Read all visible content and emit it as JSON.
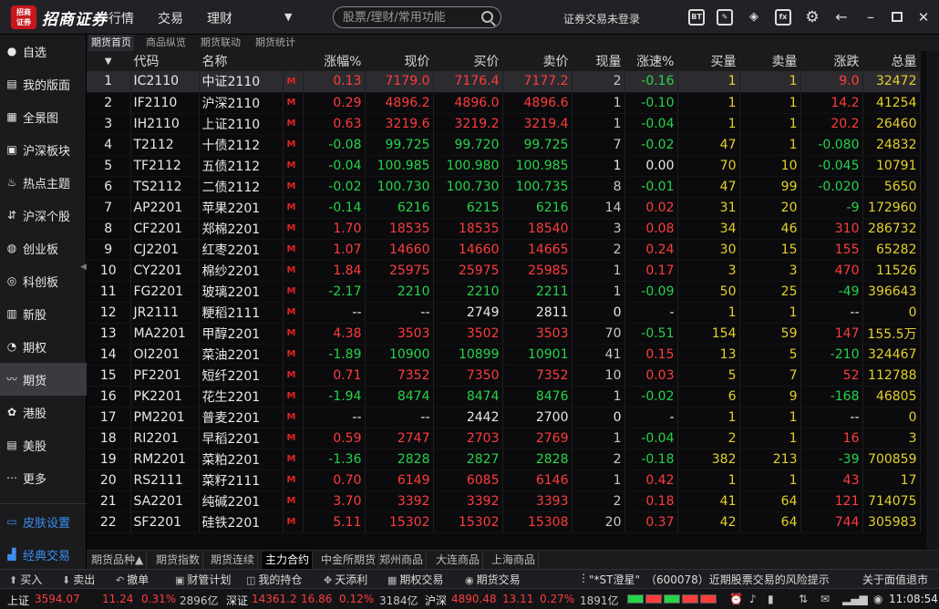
{
  "app": {
    "logo_mark": "招商证券",
    "brand": "招商证券",
    "menus": [
      "行情",
      "交易",
      "理财"
    ],
    "search_placeholder": "股票/理财/常用功能",
    "login_status": "证券交易未登录",
    "title_icons": [
      "bt-icon",
      "edit-icon",
      "cube-icon",
      "fx-icon",
      "gear-icon",
      "back-arrow-icon",
      "minimize-icon",
      "maximize-icon",
      "close-icon"
    ]
  },
  "sidebar": {
    "items": [
      {
        "label": "自选",
        "icon": "favorite-icon"
      },
      {
        "label": "我的版面",
        "icon": "layout-icon"
      },
      {
        "label": "全景图",
        "icon": "panorama-icon"
      },
      {
        "label": "沪深板块",
        "icon": "sh-sector-icon"
      },
      {
        "label": "热点主题",
        "icon": "flame-icon"
      },
      {
        "label": "沪深个股",
        "icon": "stock-icon"
      },
      {
        "label": "创业板",
        "icon": "gem-board-icon"
      },
      {
        "label": "科创板",
        "icon": "star-board-icon"
      },
      {
        "label": "新股",
        "icon": "ipo-icon"
      },
      {
        "label": "期权",
        "icon": "options-icon"
      },
      {
        "label": "期货",
        "icon": "futures-icon"
      },
      {
        "label": "港股",
        "icon": "hk-icon"
      },
      {
        "label": "美股",
        "icon": "us-icon"
      },
      {
        "label": "更多",
        "icon": "more-icon"
      }
    ],
    "active_index": 10,
    "skin_settings": "皮肤设置",
    "classic_trading": "经典交易"
  },
  "top_tabs": [
    "期货首页",
    "商品纵览",
    "期货联动",
    "期货统计"
  ],
  "top_tab_active": 0,
  "table": {
    "columns": [
      "",
      "代码",
      "名称",
      "",
      "涨幅%",
      "现价",
      "买价",
      "卖价",
      "现量",
      "涨速%",
      "买量",
      "卖量",
      "涨跌",
      "总量"
    ],
    "sort_indicator": "▼",
    "market_flag": "M",
    "rows": [
      [
        "1",
        "IC2110",
        "中证2110",
        "0.13",
        "7179.0",
        "7176.4",
        "7177.2",
        "2",
        "-0.16",
        "1",
        "1",
        "9.0",
        "32472"
      ],
      [
        "2",
        "IF2110",
        "沪深2110",
        "0.29",
        "4896.2",
        "4896.0",
        "4896.6",
        "1",
        "-0.10",
        "1",
        "1",
        "14.2",
        "41254"
      ],
      [
        "3",
        "IH2110",
        "上证2110",
        "0.63",
        "3219.6",
        "3219.2",
        "3219.4",
        "1",
        "-0.04",
        "1",
        "1",
        "20.2",
        "26460"
      ],
      [
        "4",
        "T2112",
        "十债2112",
        "-0.08",
        "99.725",
        "99.720",
        "99.725",
        "7",
        "-0.02",
        "47",
        "1",
        "-0.080",
        "24832"
      ],
      [
        "5",
        "TF2112",
        "五债2112",
        "-0.04",
        "100.985",
        "100.980",
        "100.985",
        "1",
        "0.00",
        "70",
        "10",
        "-0.045",
        "10791"
      ],
      [
        "6",
        "TS2112",
        "二债2112",
        "-0.02",
        "100.730",
        "100.730",
        "100.735",
        "8",
        "-0.01",
        "47",
        "99",
        "-0.020",
        "5650"
      ],
      [
        "7",
        "AP2201",
        "苹果2201",
        "-0.14",
        "6216",
        "6215",
        "6216",
        "14",
        "0.02",
        "31",
        "20",
        "-9",
        "172960"
      ],
      [
        "8",
        "CF2201",
        "郑棉2201",
        "1.70",
        "18535",
        "18535",
        "18540",
        "3",
        "0.08",
        "34",
        "46",
        "310",
        "286732"
      ],
      [
        "9",
        "CJ2201",
        "红枣2201",
        "1.07",
        "14660",
        "14660",
        "14665",
        "2",
        "0.24",
        "30",
        "15",
        "155",
        "65282"
      ],
      [
        "10",
        "CY2201",
        "棉纱2201",
        "1.84",
        "25975",
        "25975",
        "25985",
        "1",
        "0.17",
        "3",
        "3",
        "470",
        "11526"
      ],
      [
        "11",
        "FG2201",
        "玻璃2201",
        "-2.17",
        "2210",
        "2210",
        "2211",
        "1",
        "-0.09",
        "50",
        "25",
        "-49",
        "396643"
      ],
      [
        "12",
        "JR2111",
        "粳稻2111",
        "--",
        "--",
        "2749",
        "2811",
        "0",
        "-",
        "1",
        "1",
        "--",
        "0"
      ],
      [
        "13",
        "MA2201",
        "甲醇2201",
        "4.38",
        "3503",
        "3502",
        "3503",
        "70",
        "-0.51",
        "154",
        "59",
        "147",
        "155.5万"
      ],
      [
        "14",
        "OI2201",
        "菜油2201",
        "-1.89",
        "10900",
        "10899",
        "10901",
        "41",
        "0.15",
        "13",
        "5",
        "-210",
        "324467"
      ],
      [
        "15",
        "PF2201",
        "短纤2201",
        "0.71",
        "7352",
        "7350",
        "7352",
        "10",
        "0.03",
        "5",
        "7",
        "52",
        "112788"
      ],
      [
        "16",
        "PK2201",
        "花生2201",
        "-1.94",
        "8474",
        "8474",
        "8476",
        "1",
        "-0.02",
        "6",
        "9",
        "-168",
        "46805"
      ],
      [
        "17",
        "PM2201",
        "普麦2201",
        "--",
        "--",
        "2442",
        "2700",
        "0",
        "-",
        "1",
        "1",
        "--",
        "0"
      ],
      [
        "18",
        "RI2201",
        "早稻2201",
        "0.59",
        "2747",
        "2703",
        "2769",
        "1",
        "-0.04",
        "2",
        "1",
        "16",
        "3"
      ],
      [
        "19",
        "RM2201",
        "菜粕2201",
        "-1.36",
        "2828",
        "2827",
        "2828",
        "2",
        "-0.18",
        "382",
        "213",
        "-39",
        "700859"
      ],
      [
        "20",
        "RS2111",
        "菜籽2111",
        "0.70",
        "6149",
        "6085",
        "6146",
        "1",
        "0.42",
        "1",
        "1",
        "43",
        "17"
      ],
      [
        "21",
        "SA2201",
        "纯碱2201",
        "3.70",
        "3392",
        "3392",
        "3393",
        "2",
        "0.18",
        "41",
        "64",
        "121",
        "714075"
      ],
      [
        "22",
        "SF2201",
        "硅铁2201",
        "5.11",
        "15302",
        "15302",
        "15308",
        "20",
        "0.37",
        "42",
        "64",
        "744",
        "305983"
      ]
    ],
    "selected_row": 0
  },
  "bottom_tabs": [
    "期货品种▲",
    "期货指数",
    "期货连续",
    "主力合约",
    "中金所期货",
    "郑州商品",
    "大连商品",
    "上海商品"
  ],
  "bottom_tab_active": 3,
  "toolbar": {
    "items": [
      {
        "label": "买入",
        "icon": "buy-icon"
      },
      {
        "label": "卖出",
        "icon": "sell-icon"
      },
      {
        "label": "撤单",
        "icon": "cancel-order-icon"
      },
      {
        "label": "财管计划",
        "icon": "plan-icon"
      },
      {
        "label": "我的持仓",
        "icon": "position-icon"
      },
      {
        "label": "天添利",
        "icon": "daily-profit-icon"
      },
      {
        "label": "期权交易",
        "icon": "options-trade-icon"
      },
      {
        "label": "期货交易",
        "icon": "futures-trade-icon"
      }
    ],
    "news": "\"*ST澄星\"　（600078）近期股票交易的风险提示",
    "news_more": "关于面值退市"
  },
  "status": {
    "sh_label": "上证",
    "sh_value": "3594.07",
    "sh_change": "11.24",
    "sh_pct": "0.31%",
    "sh_amount": "2896亿",
    "sz_label": "深证",
    "sz_value": "14361.2",
    "sz_change": "16.86",
    "sz_pct": "0.12%",
    "sz_amount": "3184亿",
    "hs_label": "沪深",
    "hs_value": "4890.48",
    "hs_change": "13.11",
    "hs_pct": "0.27%",
    "hs_amount": "1891亿",
    "time": "11:08:54"
  },
  "colors": {
    "up": "#ff3c3c",
    "down": "#27d34b",
    "volume": "#e5d02b",
    "brand": "#c8161d",
    "link": "#3b8ef0"
  }
}
